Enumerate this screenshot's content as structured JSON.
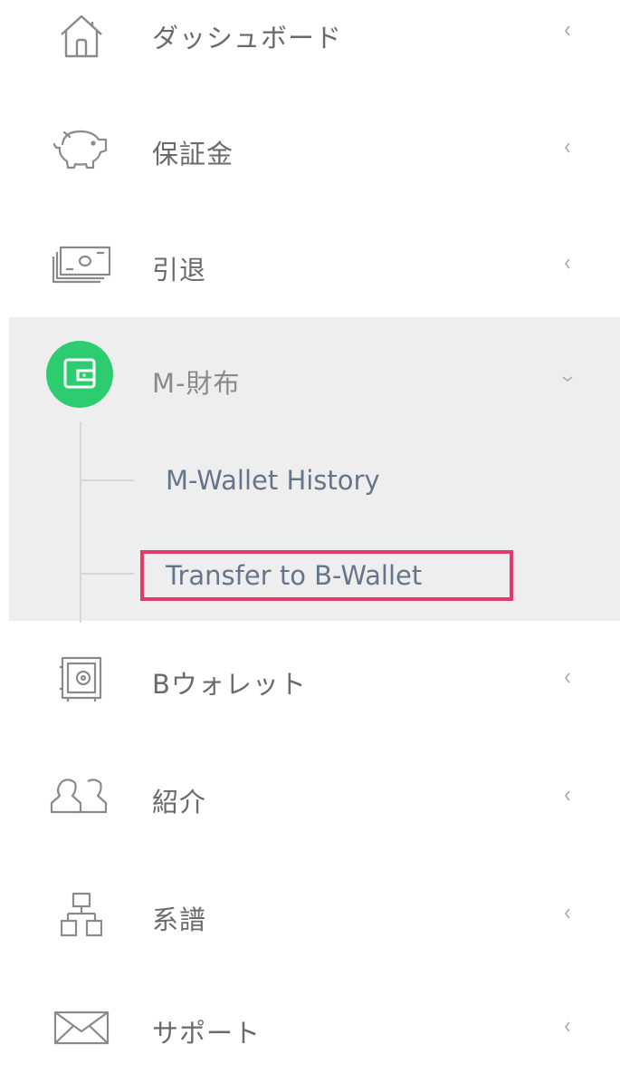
{
  "menu": {
    "dashboard": {
      "label": "ダッシュボード",
      "icon": "home-icon"
    },
    "deposit": {
      "label": "保証金",
      "icon": "piggy-bank-icon"
    },
    "withdraw": {
      "label": "引退",
      "icon": "cash-stack-icon"
    },
    "mwallet": {
      "label": "M-財布",
      "icon": "wallet-icon",
      "expanded": true,
      "accent_color": "#2ecc71",
      "children": [
        {
          "label": "M-Wallet History"
        },
        {
          "label": "Transfer to B-Wallet",
          "highlighted": true,
          "highlight_color": "#e23a6a"
        }
      ]
    },
    "bwallet": {
      "label": "Bウォレット",
      "icon": "safe-icon"
    },
    "referral": {
      "label": "紹介",
      "icon": "users-icon"
    },
    "genealogy": {
      "label": "系譜",
      "icon": "hierarchy-icon"
    },
    "support": {
      "label": "サポート",
      "icon": "envelope-icon"
    }
  },
  "chevrons": {
    "collapsed": "chevron-left-icon",
    "expanded": "chevron-down-icon"
  }
}
